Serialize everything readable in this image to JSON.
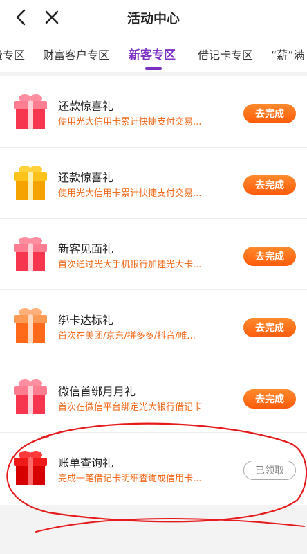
{
  "header": {
    "title": "活动中心"
  },
  "tabs": [
    {
      "label": "费专区"
    },
    {
      "label": "财富客户专区"
    },
    {
      "label": "新客专区"
    },
    {
      "label": "借记卡专区"
    },
    {
      "label": "“薪”满"
    }
  ],
  "colors": {
    "accent": "#7b2fc4",
    "action": "#ff6a14",
    "desc": "#f06a1a"
  },
  "items": [
    {
      "title": "还款惊喜礼",
      "desc": "使用光大信用卡累计快捷支付交易...",
      "button": "去完成",
      "gift": "pink-gift-icon"
    },
    {
      "title": "还款惊喜礼",
      "desc": "使用光大信用卡累计快捷支付交易...",
      "button": "去完成",
      "gift": "gold-gift-icon"
    },
    {
      "title": "新客见面礼",
      "desc": "首次通过光大手机银行加挂光大卡...",
      "button": "去完成",
      "gift": "pink-gift-icon"
    },
    {
      "title": "绑卡达标礼",
      "desc": "首次在美团/京东/拼多多/抖音/唯...",
      "button": "去完成",
      "gift": "orange-gift-icon"
    },
    {
      "title": "微信首绑月月礼",
      "desc": "首次在微信平台绑定光大银行借记卡",
      "button": "去完成",
      "gift": "pink-gift-icon"
    },
    {
      "title": "账单查询礼",
      "desc": "完成一笔借记卡明细查询或信用卡...",
      "button": "已领取",
      "gift": "red-gift-icon"
    }
  ]
}
